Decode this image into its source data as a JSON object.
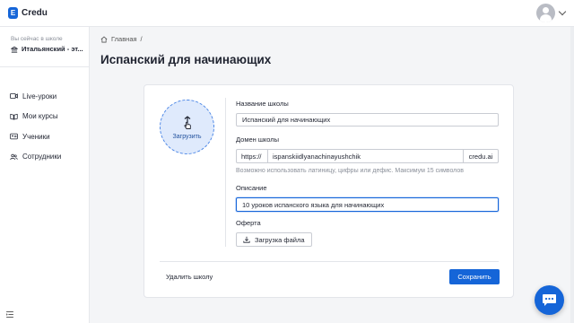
{
  "header": {
    "logo_letter": "E",
    "logo_text": "Credu"
  },
  "sidebar": {
    "school_caption": "Вы сейчас в школе",
    "school_name": "Итальянский - эт...",
    "items": [
      {
        "label": "Live-уроки",
        "icon": "video-icon"
      },
      {
        "label": "Мои курсы",
        "icon": "book-icon"
      },
      {
        "label": "Ученики",
        "icon": "id-card-icon"
      },
      {
        "label": "Сотрудники",
        "icon": "users-icon"
      }
    ]
  },
  "breadcrumb": {
    "home": "Главная",
    "separator": "/"
  },
  "page": {
    "title": "Испанский для начинающих"
  },
  "form": {
    "upload_label": "Загрузить",
    "name_label": "Название школы",
    "name_value": "Испанский для начинающих",
    "domain_label": "Домен школы",
    "domain_prefix": "https://",
    "domain_value": "ispanskiidlyanachinayushchik",
    "domain_suffix": "credu.ai",
    "domain_hint": "Возможно использовать латиницу, цифры или дефис. Максимум 15 символов",
    "description_label": "Описание",
    "description_value": "10 уроков испанского языка для начинающих",
    "offer_label": "Оферта",
    "upload_file_label": "Загрузка файла",
    "delete_label": "Удалить школу",
    "save_label": "Сохранить"
  },
  "colors": {
    "accent": "#1565d8",
    "background": "#f4f5f7",
    "upload_fill": "#dfeafc"
  }
}
